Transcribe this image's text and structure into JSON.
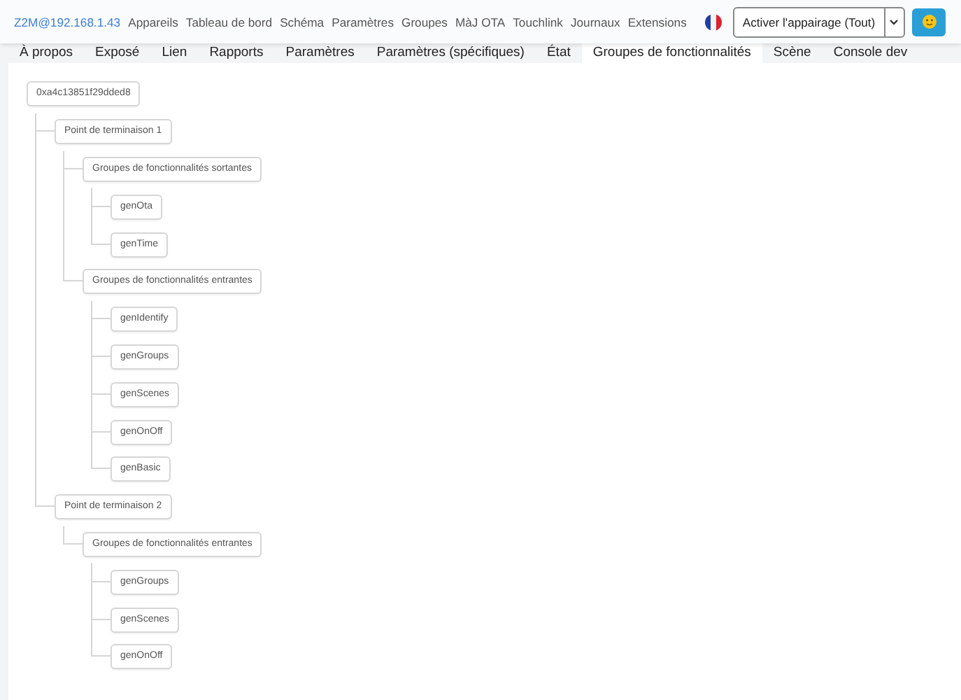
{
  "navbar": {
    "brand": "Z2M@192.168.1.43",
    "links": [
      "Appareils",
      "Tableau de bord",
      "Schéma",
      "Paramètres",
      "Groupes",
      "MàJ OTA",
      "Touchlink",
      "Journaux",
      "Extensions"
    ],
    "pairing_select": {
      "value": "Activer l'appairage (Tout)"
    }
  },
  "tabs": [
    {
      "label": "À propos",
      "selected": false
    },
    {
      "label": "Exposé",
      "selected": false
    },
    {
      "label": "Lien",
      "selected": false
    },
    {
      "label": "Rapports",
      "selected": false
    },
    {
      "label": "Paramètres",
      "selected": false
    },
    {
      "label": "Paramètres (spécifiques)",
      "selected": false
    },
    {
      "label": "État",
      "selected": false
    },
    {
      "label": "Groupes de fonctionnalités",
      "selected": true
    },
    {
      "label": "Scène",
      "selected": false
    },
    {
      "label": "Console dev",
      "selected": false
    }
  ],
  "tree": {
    "label": "0xa4c13851f29dded8",
    "children": [
      {
        "label": "Point de terminaison 1",
        "children": [
          {
            "label": "Groupes de fonctionnalités sortantes",
            "children": [
              {
                "label": "genOta"
              },
              {
                "label": "genTime"
              }
            ]
          },
          {
            "label": "Groupes de fonctionnalités entrantes",
            "children": [
              {
                "label": "genIdentify"
              },
              {
                "label": "genGroups"
              },
              {
                "label": "genScenes"
              },
              {
                "label": "genOnOff"
              },
              {
                "label": "genBasic"
              }
            ]
          }
        ]
      },
      {
        "label": "Point de terminaison 2",
        "children": [
          {
            "label": "Groupes de fonctionnalités entrantes",
            "children": [
              {
                "label": "genGroups"
              },
              {
                "label": "genScenes"
              },
              {
                "label": "genOnOff"
              }
            ]
          }
        ]
      }
    ]
  }
}
